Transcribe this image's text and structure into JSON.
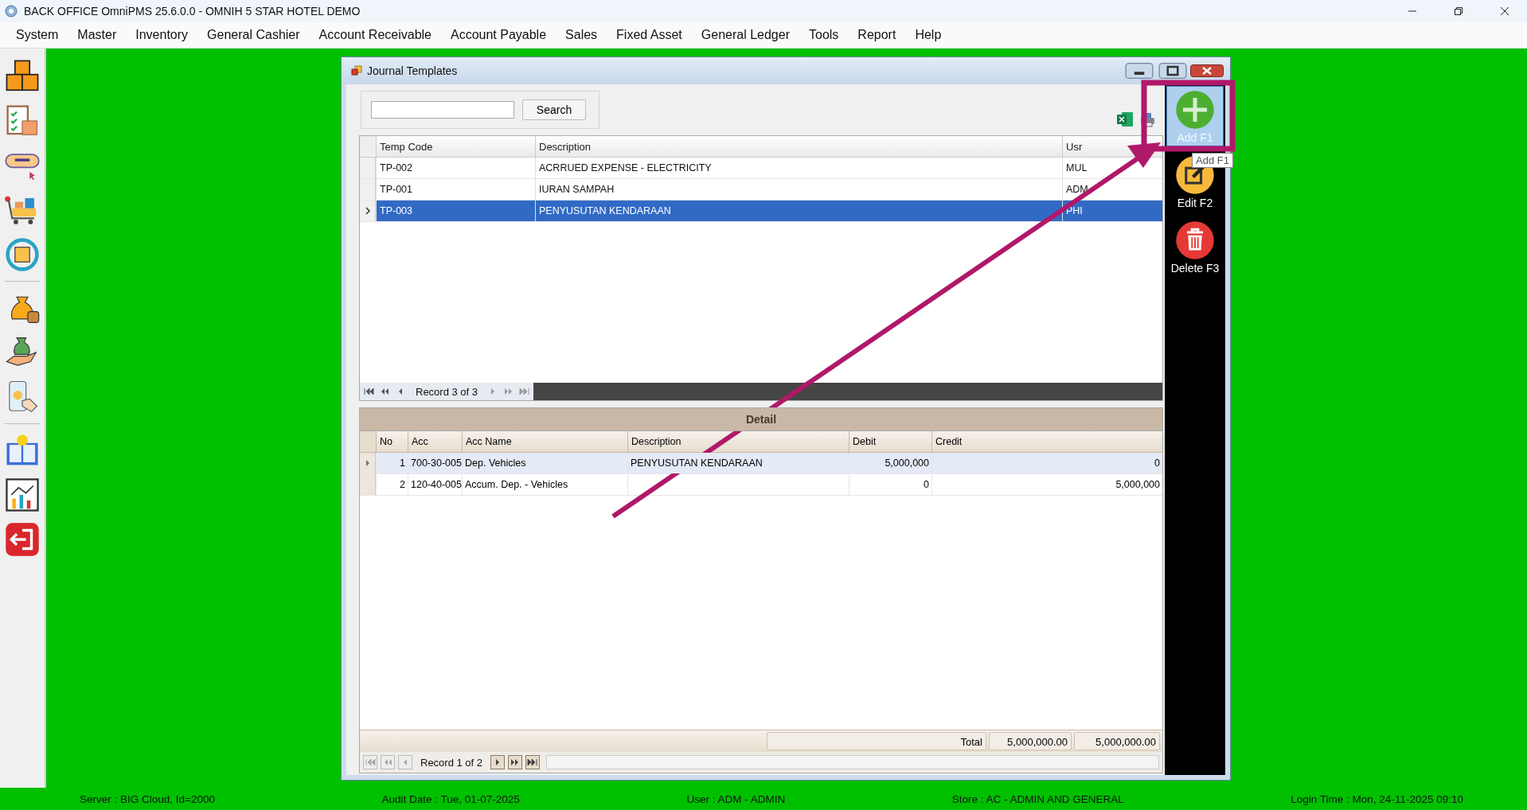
{
  "app": {
    "title": "BACK OFFICE OmniPMS 25.6.0.0 - OMNIH 5 STAR HOTEL DEMO"
  },
  "menu": [
    "System",
    "Master",
    "Inventory",
    "General Cashier",
    "Account Receivable",
    "Account Payable",
    "Sales",
    "Fixed Asset",
    "General Ledger",
    "Tools",
    "Report",
    "Help"
  ],
  "dialog": {
    "title": "Journal Templates",
    "search": {
      "button": "Search"
    },
    "actions": [
      {
        "kind": "add",
        "label": "Add F1",
        "selected": true
      },
      {
        "kind": "edit",
        "label": "Edit F2",
        "selected": false
      },
      {
        "kind": "delete",
        "label": "Delete F3",
        "selected": false
      }
    ],
    "tooltip": "Add F1",
    "templates": {
      "columns": [
        "Temp Code",
        "Description",
        "Usr"
      ],
      "rows": [
        {
          "cells": [
            "TP-002",
            "ACRRUED EXPENSE - ELECTRICITY",
            "MUL"
          ],
          "selected": false
        },
        {
          "cells": [
            "TP-001",
            "IURAN SAMPAH",
            "ADM"
          ],
          "selected": false
        },
        {
          "cells": [
            "TP-003",
            "PENYUSUTAN KENDARAAN",
            "PHI"
          ],
          "selected": true
        }
      ],
      "navigator": "Record 3 of 3"
    },
    "detail": {
      "title": "Detail",
      "columns": [
        "No",
        "Acc",
        "Acc Name",
        "Description",
        "Debit",
        "Credit"
      ],
      "rows": [
        {
          "cells": [
            "1",
            "700-30-005",
            "Dep. Vehicles",
            "PENYUSUTAN KENDARAAN",
            "5,000,000",
            "0"
          ],
          "selected": true
        },
        {
          "cells": [
            "2",
            "120-40-005",
            "Accum. Dep. - Vehicles",
            "",
            "0",
            "5,000,000"
          ],
          "selected": false
        }
      ],
      "total_label": "Total",
      "totals": [
        "5,000,000.00",
        "5,000,000.00"
      ],
      "navigator": "Record 1 of 2"
    }
  },
  "status_bar": [
    "Server : BIG Cloud, Id=2000",
    "Audit Date : Tue, 01-07-2025",
    "User : ADM - ADMIN",
    "Store : AC - ADMIN AND GENERAL",
    "Login Time : Mon, 24-11-2025 09:10"
  ]
}
